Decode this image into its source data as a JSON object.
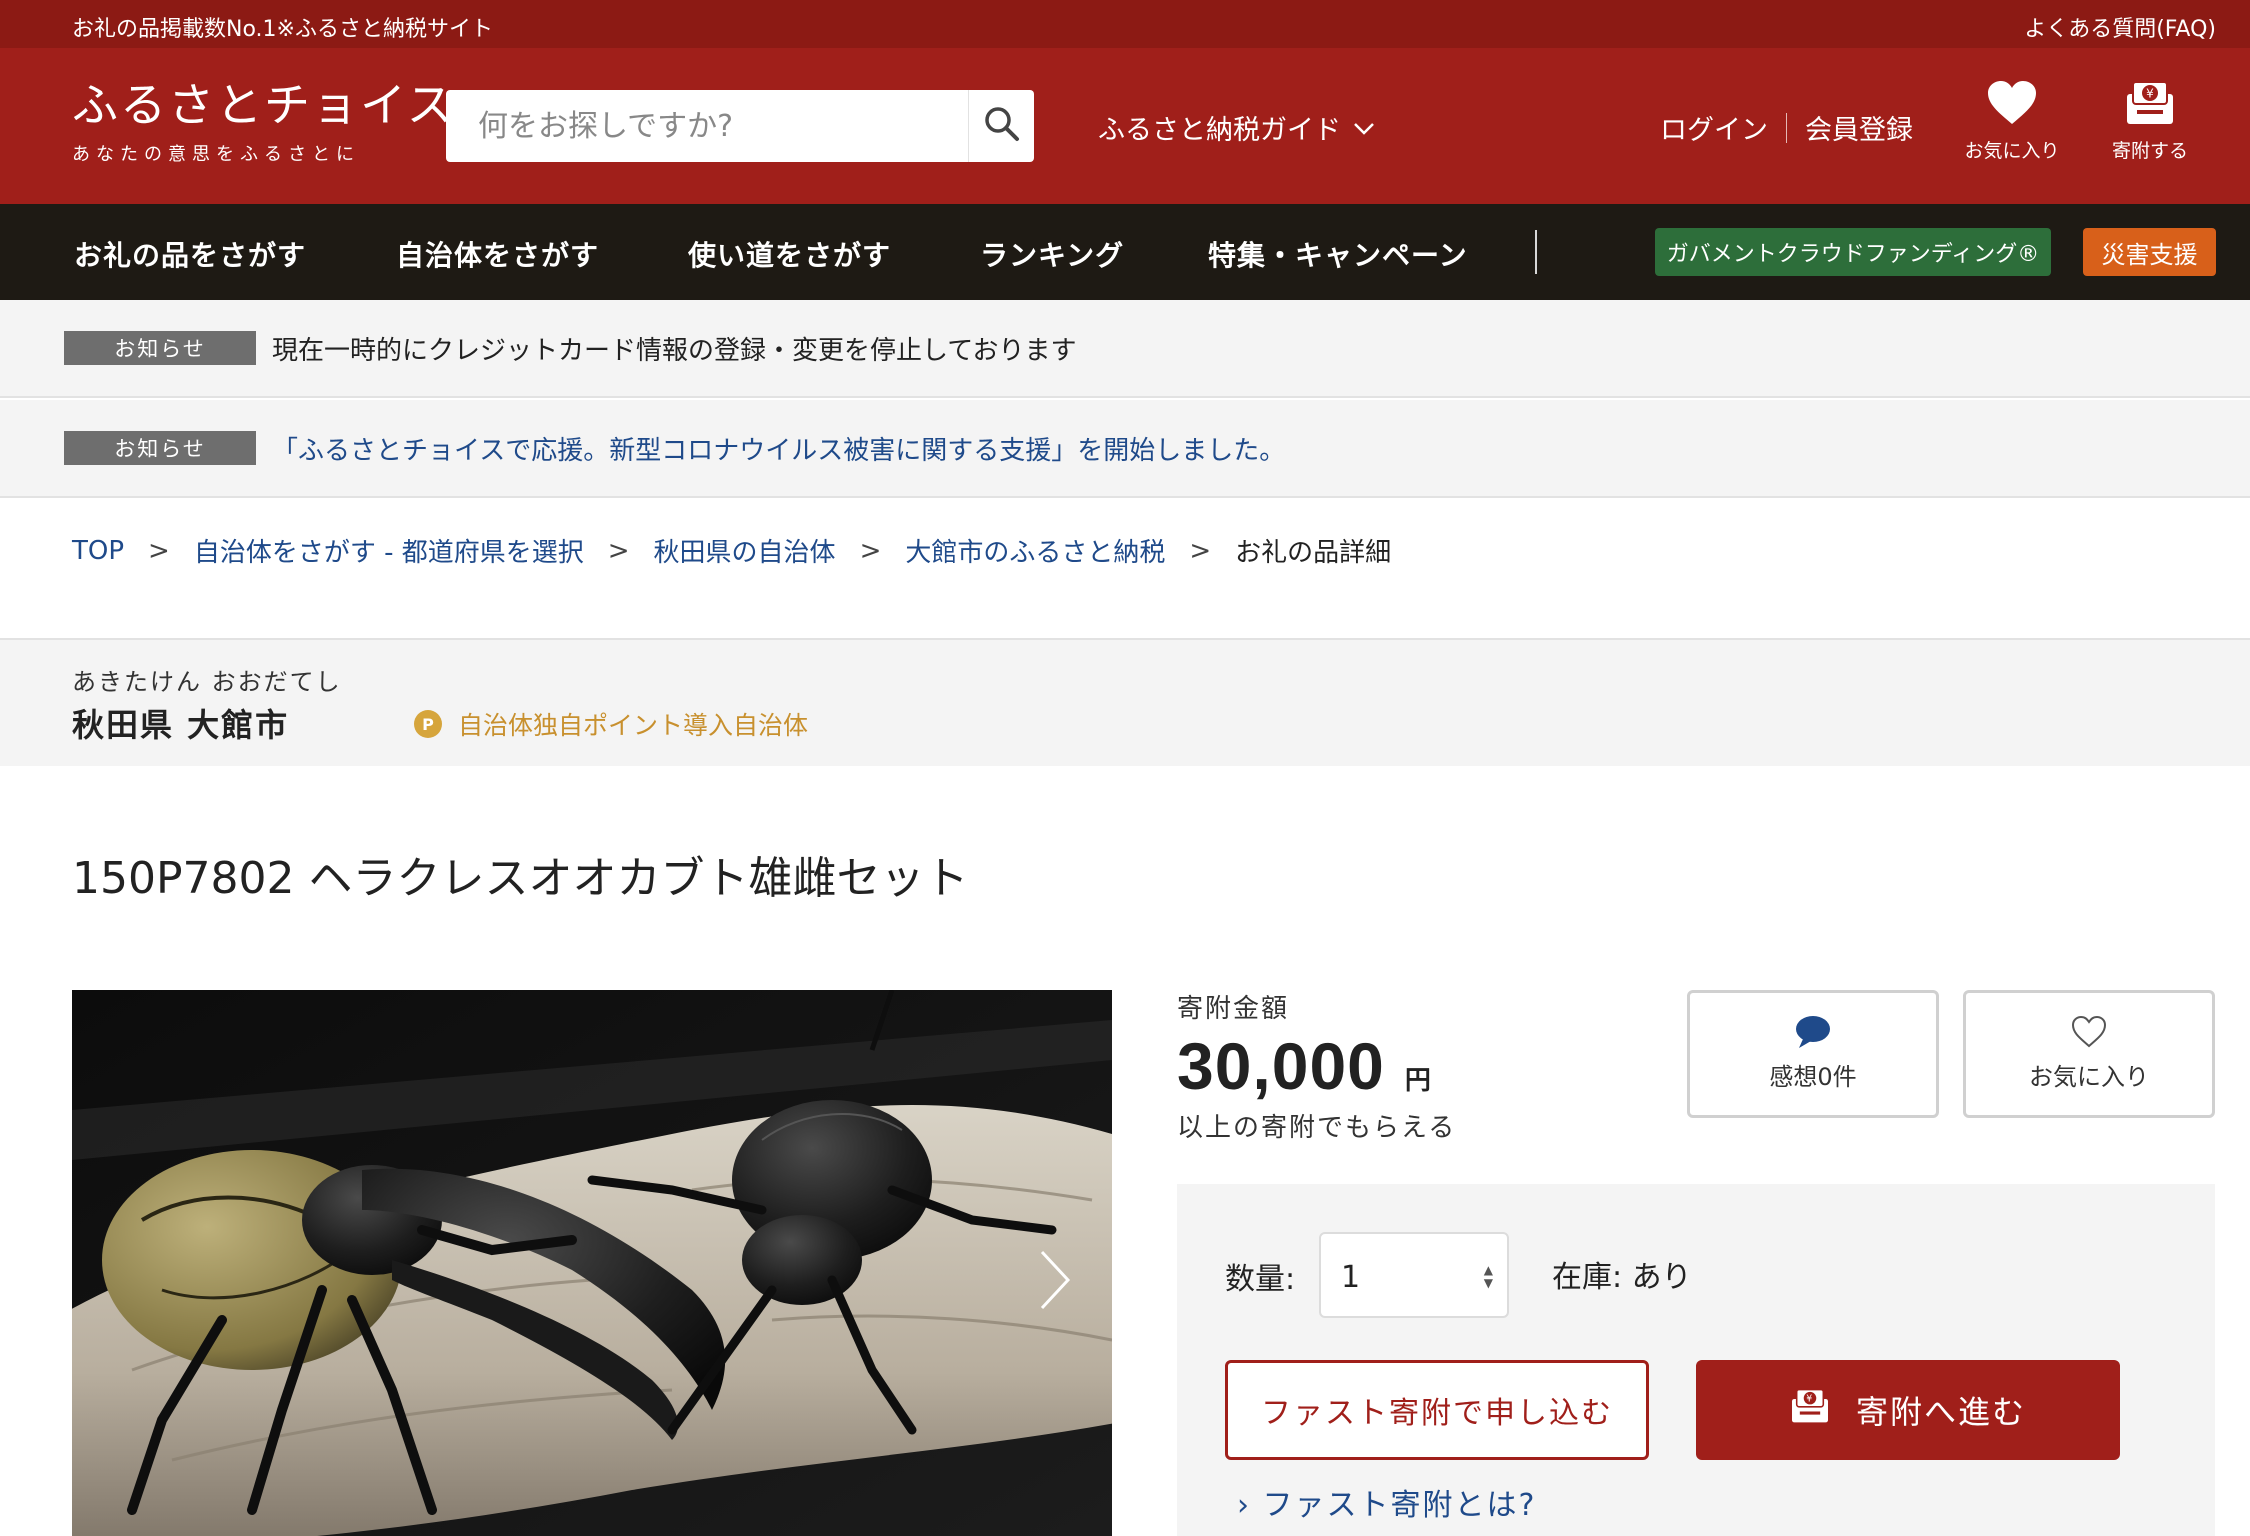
{
  "topstrip": {
    "tagline": "お礼の品掲載数No.1※ふるさと納税サイト",
    "faq": "よくある質問(FAQ)"
  },
  "header": {
    "logo_main": "ふるさとチョイス",
    "logo_sub": "あなたの意思をふるさとに",
    "search_placeholder": "何をお探しですか?",
    "guide": "ふるさと納税ガイド",
    "login": "ログイン",
    "register": "会員登録",
    "favorites": "お気に入り",
    "donate": "寄附する"
  },
  "nav": {
    "items": [
      "お礼の品をさがす",
      "自治体をさがす",
      "使い道をさがす",
      "ランキング",
      "特集・キャンペーン"
    ],
    "gcf": "ガバメントクラウドファンディング®",
    "disaster": "災害支援"
  },
  "notices": [
    {
      "label": "お知らせ",
      "text": "現在一時的にクレジットカード情報の登録・変更を停止しております"
    },
    {
      "label": "お知らせ",
      "text": "「ふるさとチョイスで応援。新型コロナウイルス被害に関する支援」を開始しました。"
    }
  ],
  "breadcrumb": {
    "links": [
      "TOP",
      "自治体をさがす - 都道府県を選択",
      "秋田県の自治体",
      "大館市のふるさと納税"
    ],
    "current": "お礼の品詳細",
    "separator": ">"
  },
  "municipality": {
    "kana": "あきたけん おおだてし",
    "name": "秋田県 大館市",
    "point_icon": "P",
    "point_label": "自治体独自ポイント導入自治体"
  },
  "product": {
    "title": "150P7802 ヘラクレスオオカブト雄雌セット",
    "image_alt": "ヘラクレスオオカブト",
    "amount_label": "寄附金額",
    "amount": "30,000",
    "yen": "円",
    "amount_sub": "以上の寄附でもらえる",
    "review": "感想0件",
    "favorite": "お気に入り"
  },
  "purchase": {
    "qty_label": "数量:",
    "qty_value": "1",
    "stock": "在庫: あり",
    "fast_button": "ファスト寄附で申し込む",
    "go_button": "寄附へ進む",
    "fast_link": "› ファスト寄附とは?"
  },
  "colors": {
    "header_red": "#a01f1a",
    "strip_red": "#8c1a14",
    "nav_dark": "#1e1a14",
    "gcf_green": "#2d6e3a",
    "disaster_orange": "#d8601a",
    "link_blue": "#1f4a8a",
    "point_gold": "#c8902e"
  },
  "icons": [
    "search-icon",
    "chevron-down-icon",
    "heart-icon",
    "donate-box-icon",
    "speech-bubble-icon",
    "heart-outline-icon",
    "chevron-right-icon",
    "updown-arrow-icon"
  ]
}
